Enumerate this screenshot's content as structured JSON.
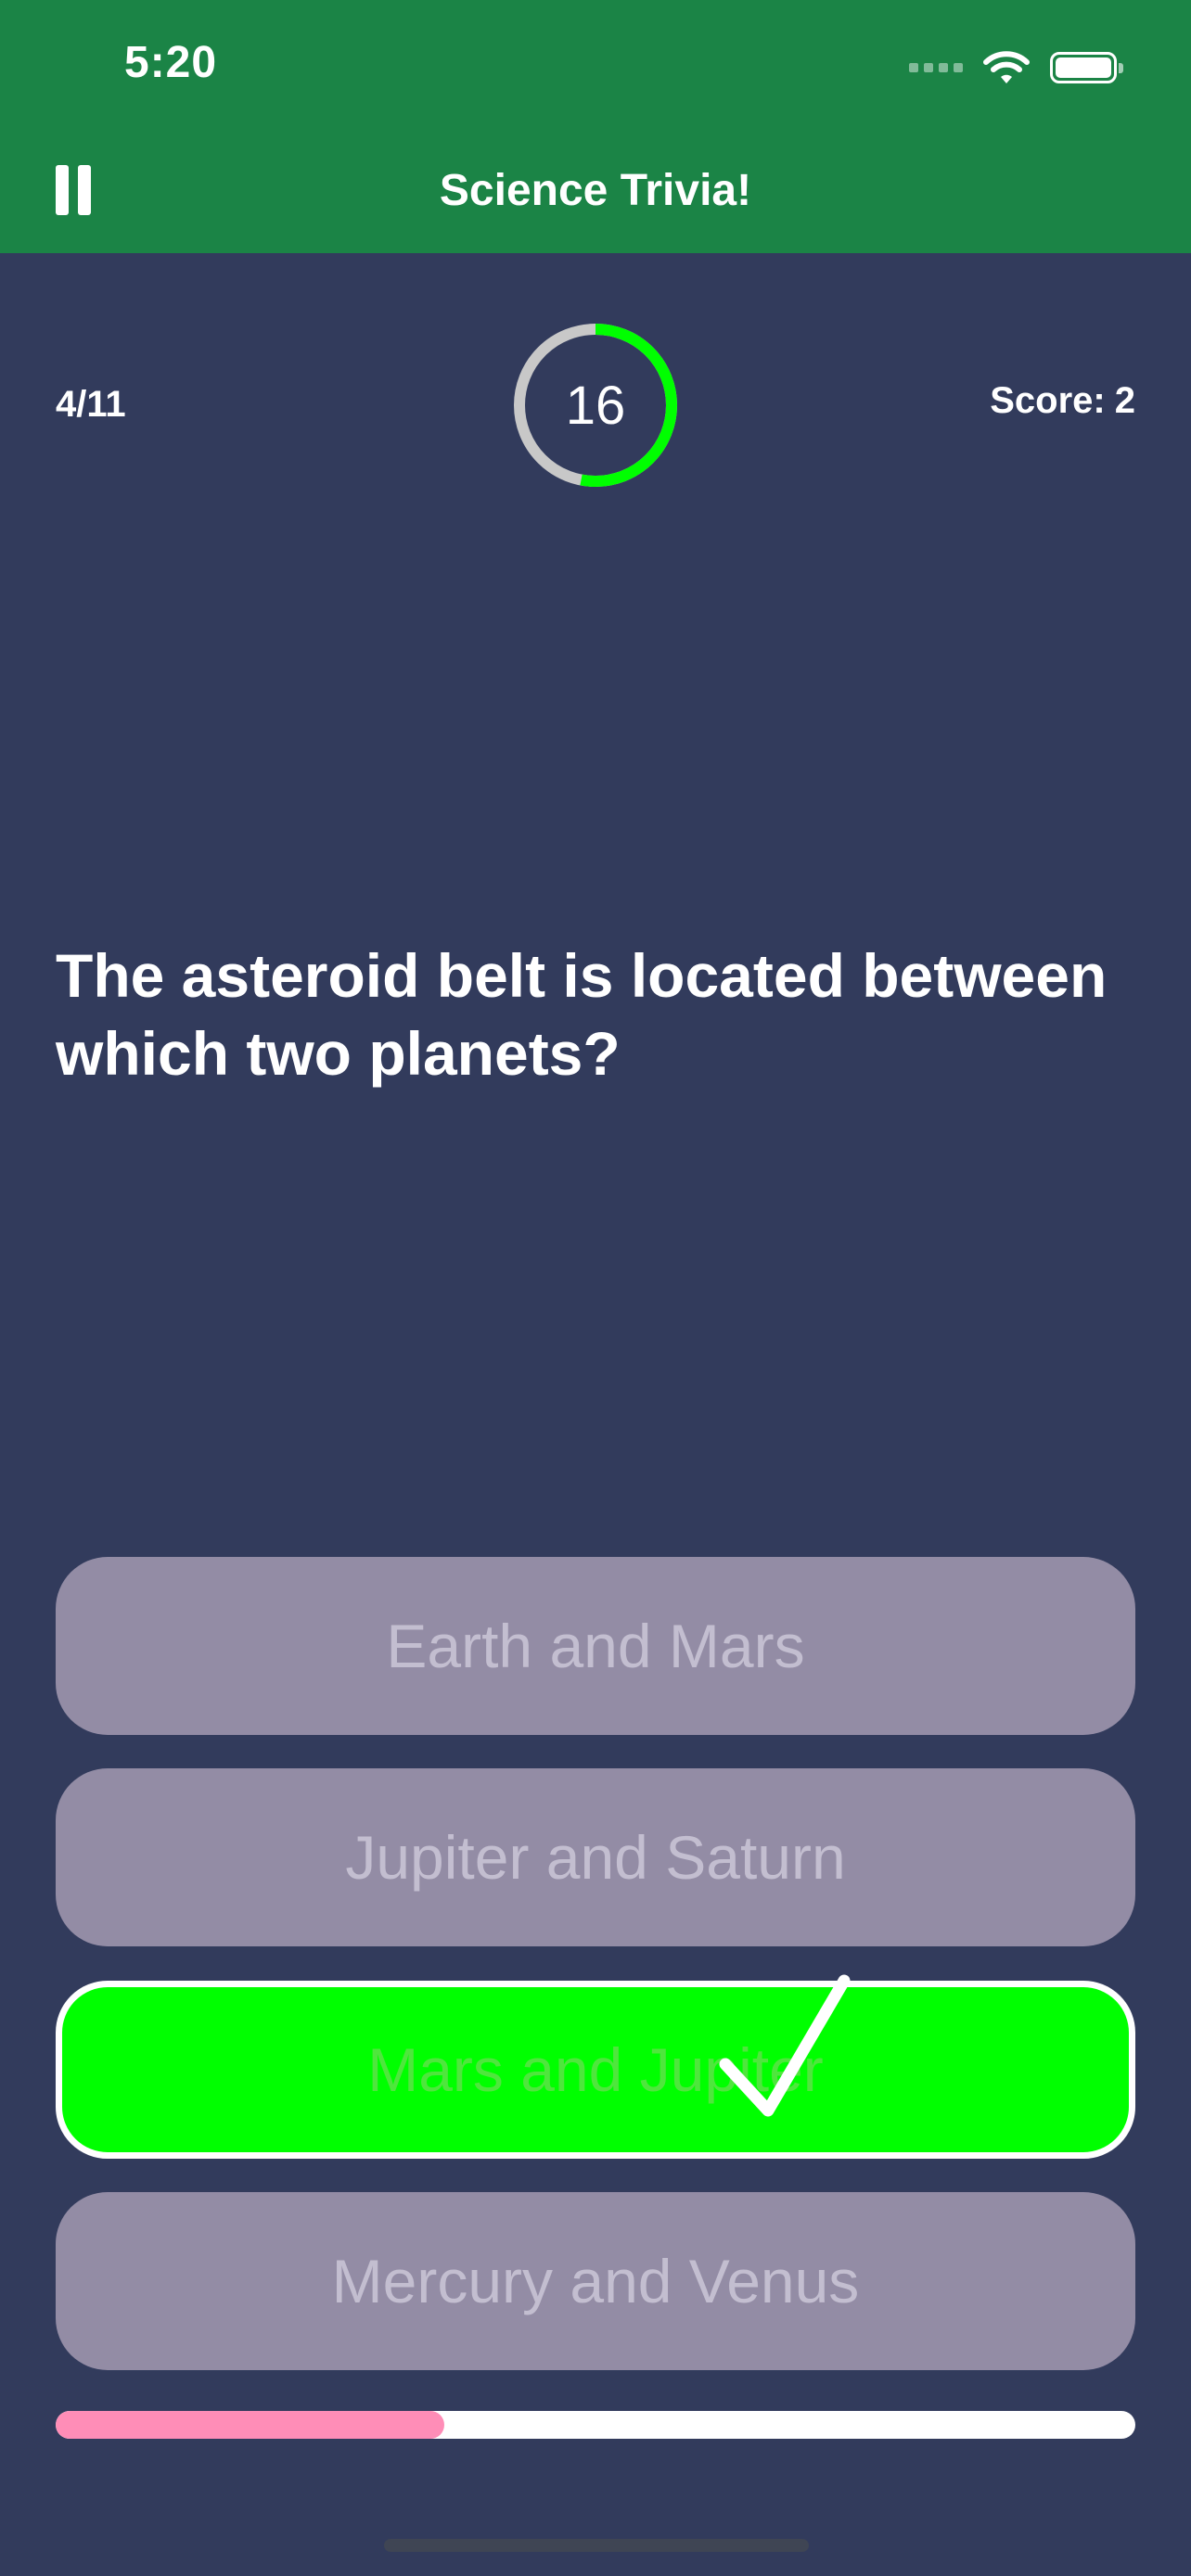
{
  "status_bar": {
    "time": "5:20",
    "icons": [
      "cellular-signal-icon",
      "wifi-icon",
      "battery-icon"
    ]
  },
  "header": {
    "title": "Science Trivia!",
    "pause_icon": "pause-icon",
    "background_color": "#1b8446"
  },
  "stats": {
    "question_counter": "4/11",
    "score_label": "Score:",
    "score_value": "2",
    "timer_value": "16",
    "timer_remaining_fraction": 0.53,
    "timer_color": "#00ff00"
  },
  "question": {
    "text": "The asteroid belt is located between which two planets?"
  },
  "answers": [
    {
      "label": "Earth and Mars",
      "state": "disabled"
    },
    {
      "label": "Jupiter and Saturn",
      "state": "disabled"
    },
    {
      "label": "Mars and Jupiter",
      "state": "correct"
    },
    {
      "label": "Mercury and Venus",
      "state": "disabled"
    }
  ],
  "feedback_icon": "checkmark-icon",
  "progress": {
    "fraction": 0.36,
    "fill_color": "#ff8db7"
  },
  "colors": {
    "background": "#323b5c",
    "answer_disabled": "#938ca5",
    "answer_correct": "#00ff00"
  }
}
